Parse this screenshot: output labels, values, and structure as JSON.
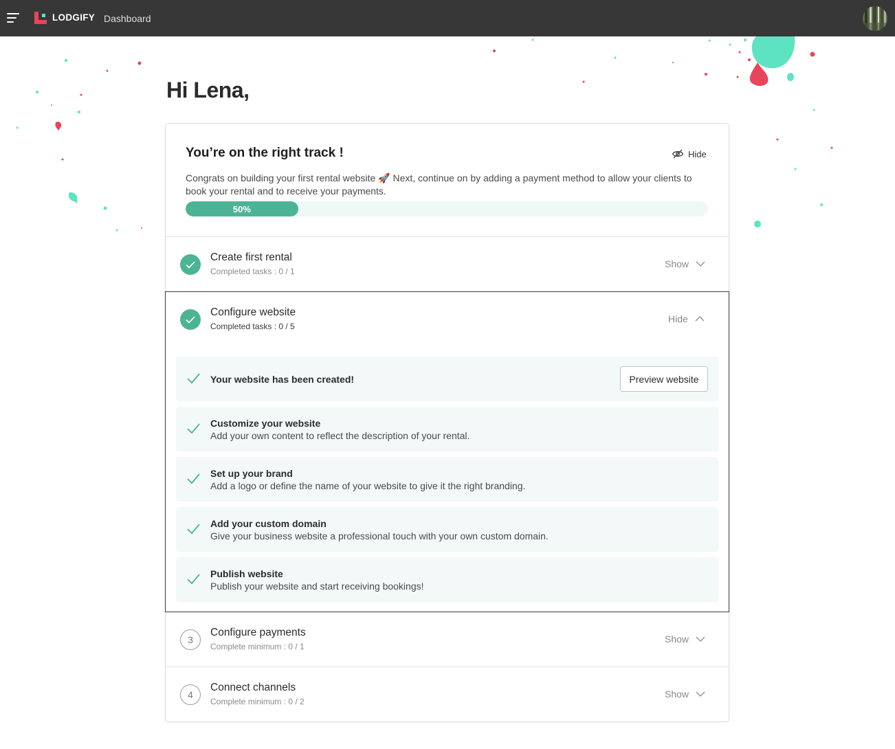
{
  "topbar": {
    "logo_text": "LODGIFY",
    "page_name": "Dashboard"
  },
  "greeting": "Hi Lena,",
  "card": {
    "title": "You’re on the right track !",
    "hide_label": "Hide",
    "description": "Congrats on building your first rental website 🚀 Next, continue on by adding a payment method to allow your clients to book your rental and to receive your payments.",
    "progress_percent": 50,
    "progress_label": "50%"
  },
  "sections": [
    {
      "title": "Create first rental",
      "subtitle": "Completed tasks : 0 / 1",
      "toggle_label": "Show",
      "status": "done"
    },
    {
      "title": "Configure website",
      "subtitle": "Completed tasks : 0 / 5",
      "toggle_label": "Hide",
      "status": "done",
      "tasks": [
        {
          "title": "Your website has been created!",
          "description": "",
          "button_label": "Preview website"
        },
        {
          "title": "Customize your website",
          "description": "Add your own content to reflect the description of your rental."
        },
        {
          "title": "Set up your brand",
          "description": "Add a logo or define the name of your website to give it the right branding."
        },
        {
          "title": "Add your custom domain",
          "description": "Give your business website a professional touch with your own custom domain."
        },
        {
          "title": "Publish website",
          "description": "Publish your website and start receiving bookings!"
        }
      ]
    },
    {
      "number": "3",
      "title": "Configure payments",
      "subtitle": "Complete minimum : 0 / 1",
      "toggle_label": "Show",
      "status": "pending"
    },
    {
      "number": "4",
      "title": "Connect channels",
      "subtitle": "Complete minimum : 0 / 2",
      "toggle_label": "Show",
      "status": "pending"
    }
  ],
  "colors": {
    "topbar": "#373737",
    "brand_red": "#e8455b",
    "accent_green": "#4cb495",
    "confetti_mint": "#5de3c2",
    "task_bg": "#f2f9f8"
  }
}
